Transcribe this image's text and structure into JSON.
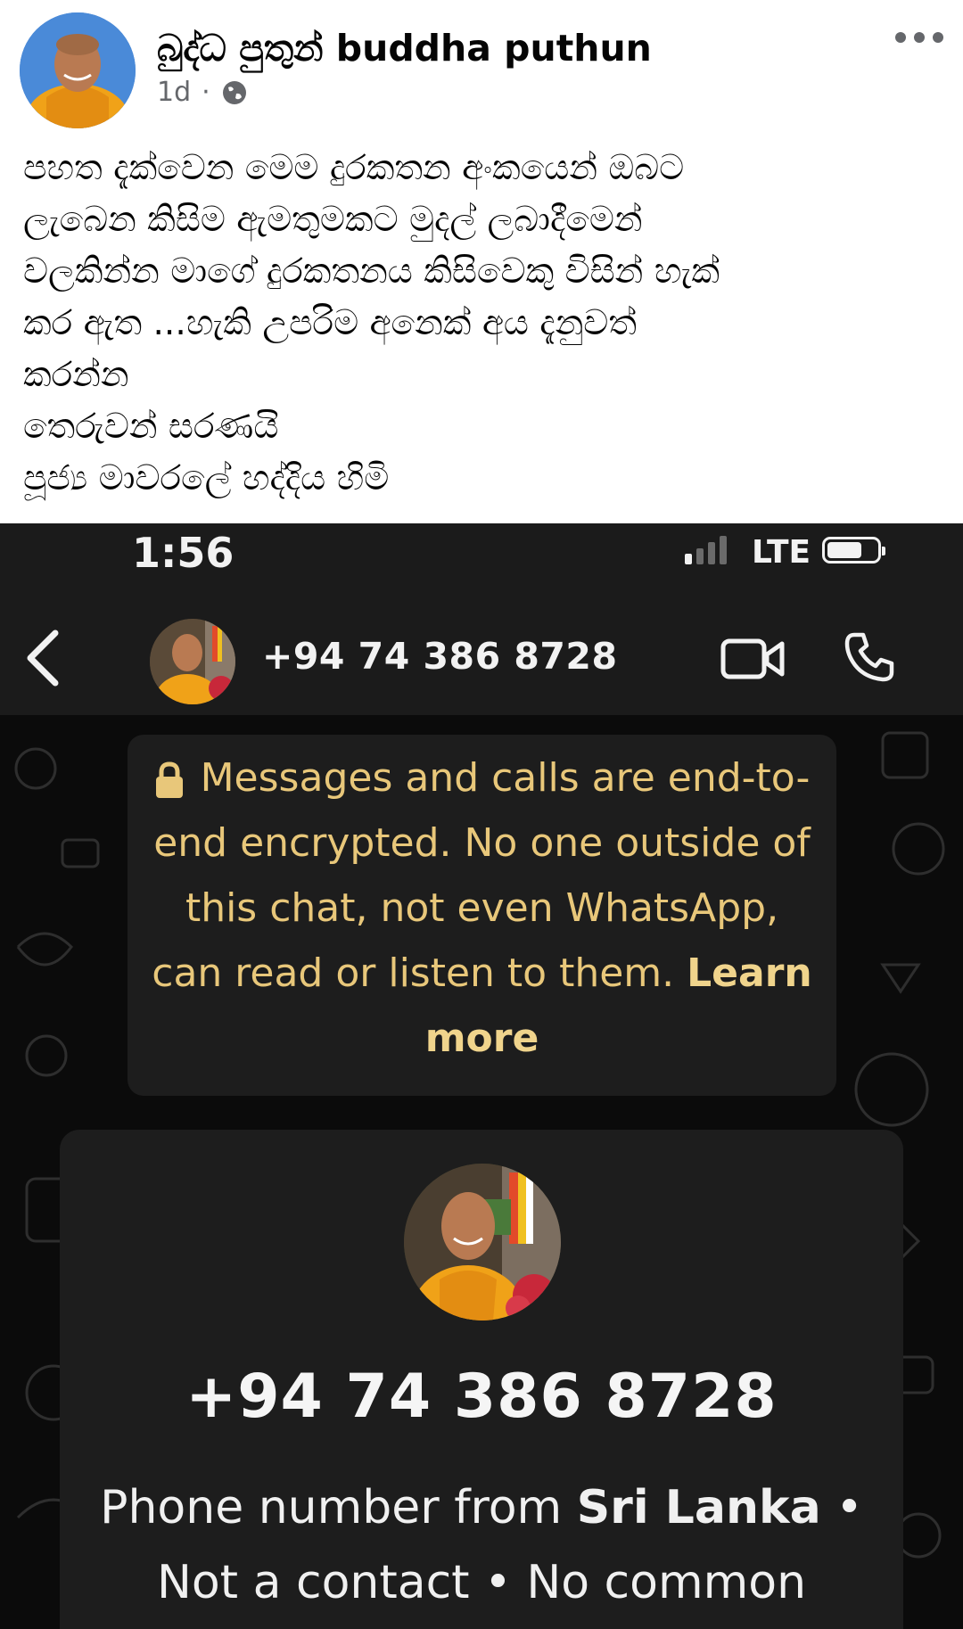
{
  "post": {
    "author": "බුද්ධ පුතුන් buddha puthun",
    "time": "1d",
    "separator": "·",
    "privacy_icon": "globe-icon",
    "more_icon": "more-dots-icon",
    "lines": [
      "පහත දැක්වෙන මෙම දුරකතන අංකයෙන් ඔබට",
      "ලැබෙන කිසිම ඇමතුමකට මුදල් ලබාදීමෙන්",
      "වලකින්න මාගේ දුරකතනය කිසිවෙකු විසින් හැක්",
      "කර ඇත ...හැකි උපරිම අනෙක් අය දැනුවත්",
      "කරන්න",
      "තෙරුවන් සරණයි",
      "පූජ්‍ය මාවරලේ හද්දිය හිමි"
    ]
  },
  "whatsapp": {
    "status_bar": {
      "time": "1:56",
      "network": "LTE"
    },
    "header": {
      "number": "+94 74 386 8728",
      "back_icon": "chevron-left-icon",
      "video_icon": "video-camera-icon",
      "call_icon": "phone-icon"
    },
    "encryption_notice": {
      "text": "Messages and calls are end-to-end encrypted. No one outside of this chat, not even WhatsApp, can read or listen to them.",
      "link": "Learn more"
    },
    "contact_card": {
      "number": "+94 74 386 8728",
      "info_prefix": "Phone number from ",
      "country": "Sri Lanka",
      "bullet": "•",
      "not_contact": "Not a contact",
      "common": "No common"
    },
    "colors": {
      "accent": "#e8c77a",
      "bubble": "#1d1d1d",
      "background": "#0b0b0b"
    }
  }
}
